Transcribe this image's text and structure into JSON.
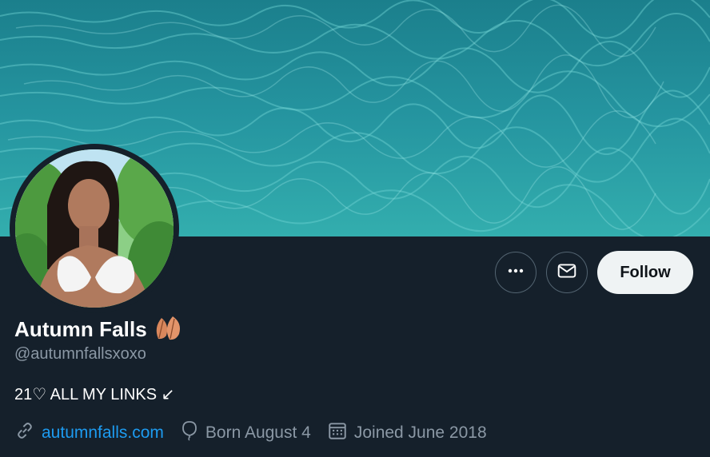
{
  "profile": {
    "display_name": "Autumn Falls",
    "name_emoji_icon": "fallen-leaf-icon",
    "handle": "@autumnfallsxoxo",
    "bio": "21♡ ALL MY LINKS ↙"
  },
  "actions": {
    "more_icon": "more-dots-icon",
    "message_icon": "envelope-icon",
    "follow_label": "Follow"
  },
  "meta": {
    "website": "autumnfalls.com",
    "birthday": "Born August 4",
    "joined": "Joined June 2018"
  },
  "colors": {
    "background": "#15202b",
    "link": "#1d9bf0",
    "muted": "#8b98a5",
    "follow_bg": "#eff3f4"
  }
}
